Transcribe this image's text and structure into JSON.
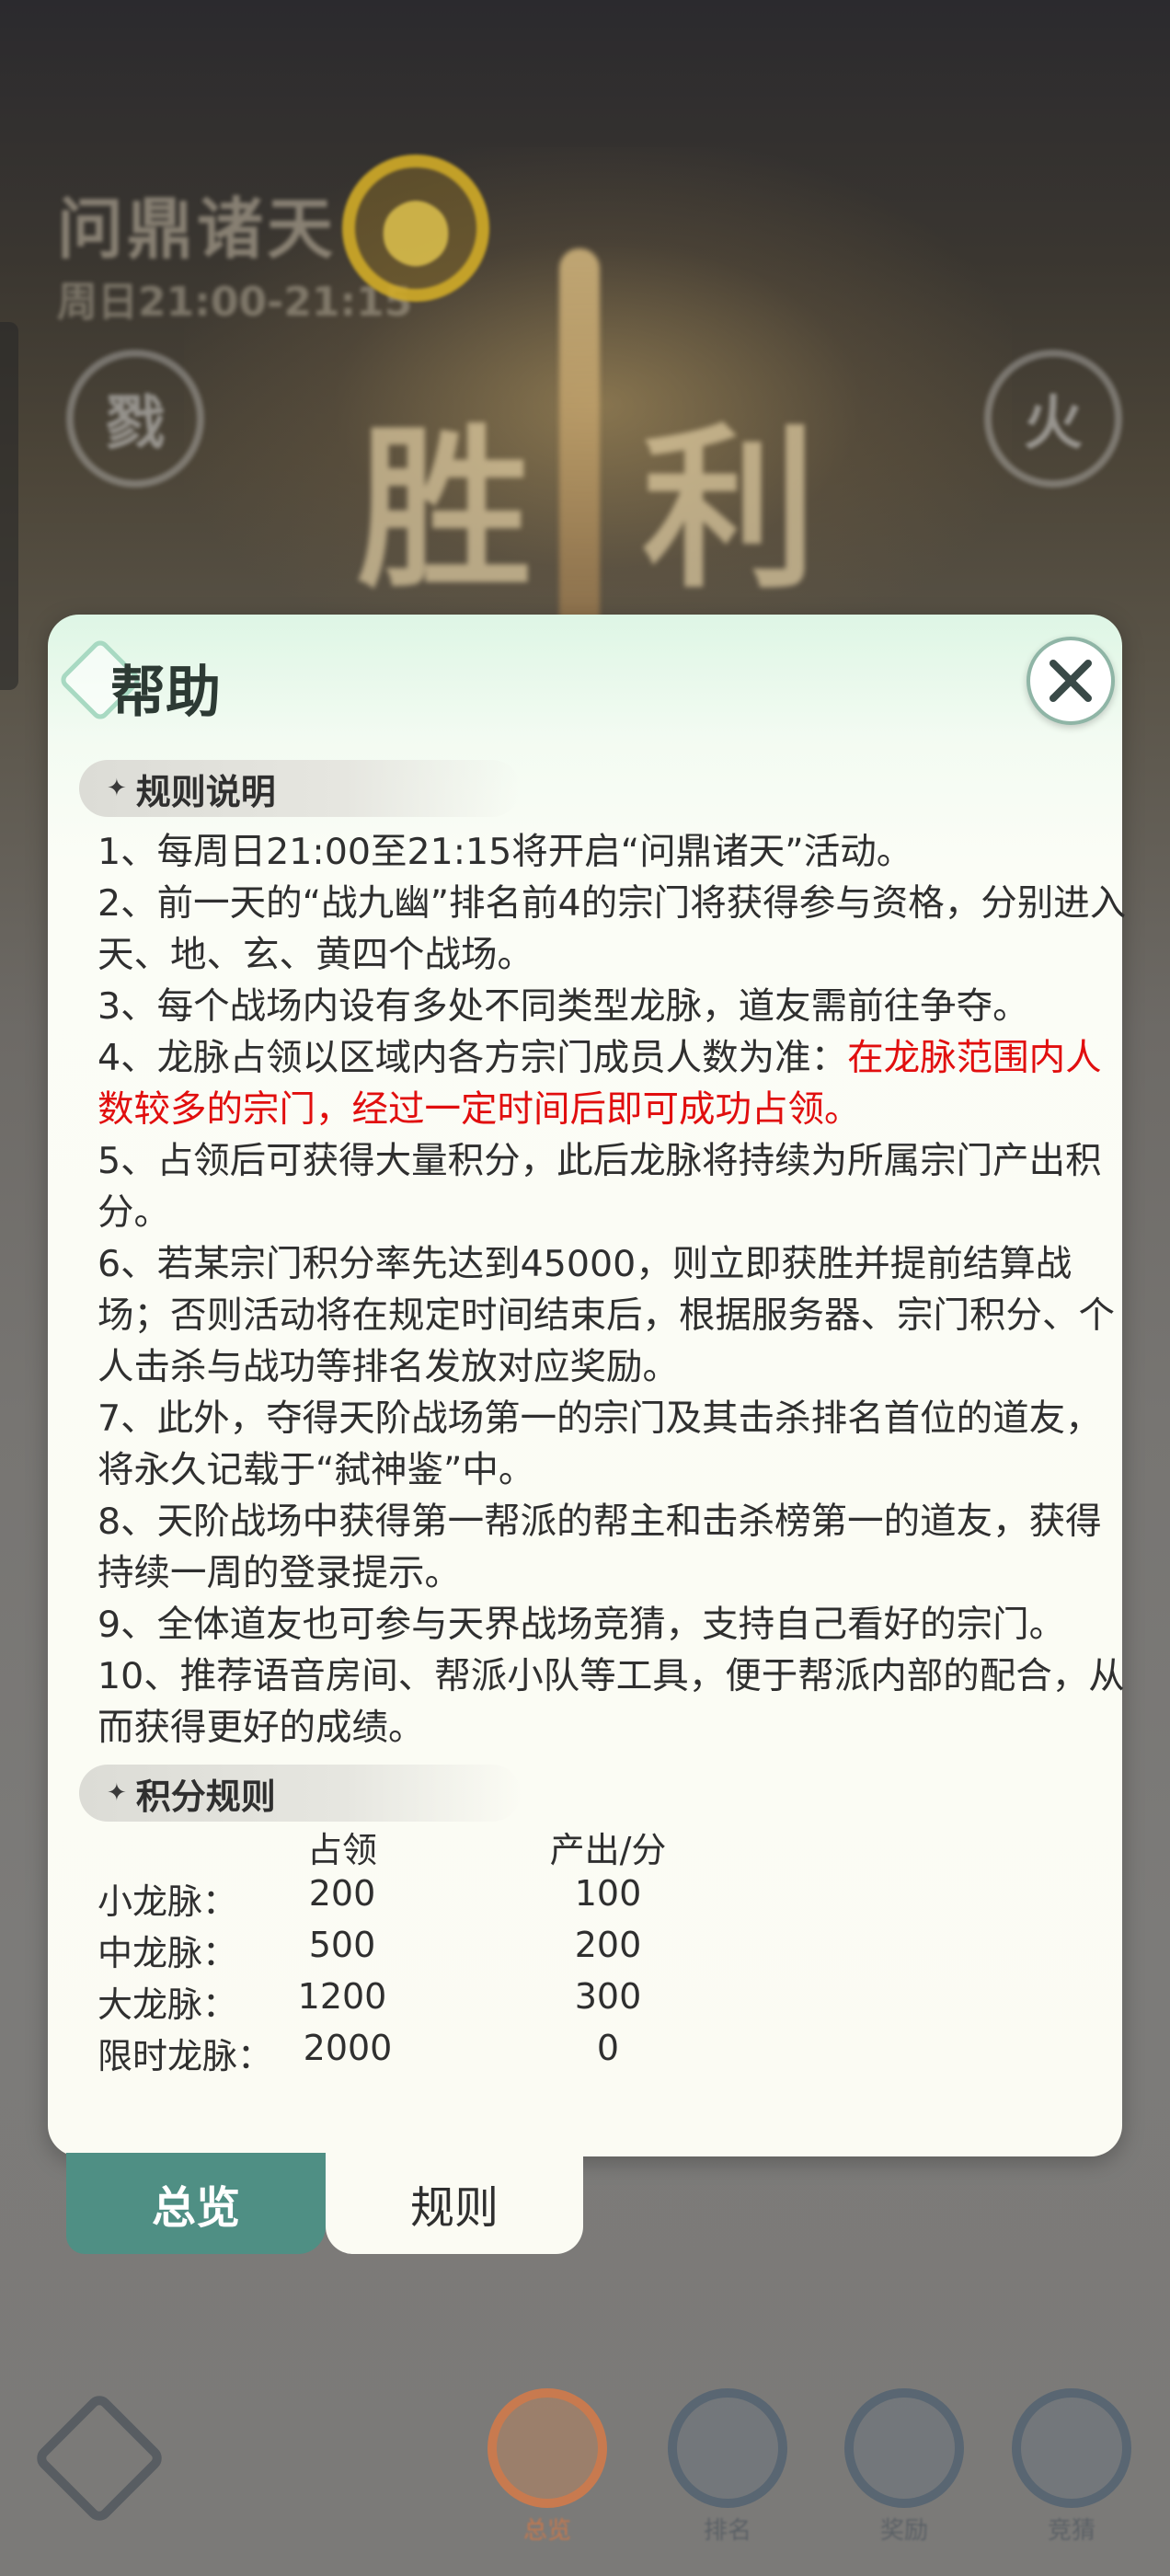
{
  "background": {
    "event_title": "问鼎诸天",
    "event_time": "周日21:00-21:15",
    "victory_text": "胜利",
    "left_icon_glyph": "戮",
    "right_icon_glyph": "火"
  },
  "dialog": {
    "title": "帮助",
    "close_icon": "close-icon",
    "sections": {
      "rules_header": "规则说明",
      "score_header": "积分规则"
    },
    "rules": [
      {
        "text": "1、每周日21:00至21:15将开启“问鼎诸天”活动。"
      },
      {
        "text": "2、前一天的“战九幽”排名前4的宗门将获得参与资格，分别进入天、地、玄、黄四个战场。"
      },
      {
        "text": "3、每个战场内设有多处不同类型龙脉，道友需前往争夺。"
      },
      {
        "text": "4、龙脉占领以区域内各方宗门成员人数为准：",
        "highlight": "在龙脉范围内人数较多的宗门，经过一定时间后即可成功占领。"
      },
      {
        "text": "5、占领后可获得大量积分，此后龙脉将持续为所属宗门产出积分。"
      },
      {
        "text": "6、若某宗门积分率先达到45000，则立即获胜并提前结算战场；否则活动将在规定时间结束后，根据服务器、宗门积分、个人击杀与战功等排名发放对应奖励。"
      },
      {
        "text": "7、此外，夺得天阶战场第一的宗门及其击杀排名首位的道友，将永久记载于“弑神鉴”中。"
      },
      {
        "text": "8、天阶战场中获得第一帮派的帮主和击杀榜第一的道友，获得持续一周的登录提示。"
      },
      {
        "text": "9、全体道友也可参与天界战场竞猜，支持自己看好的宗门。"
      },
      {
        "text": "10、推荐语音房间、帮派小队等工具，便于帮派内部的配合，从而获得更好的成绩。"
      }
    ],
    "score_table": {
      "headers": [
        "",
        "占领",
        "产出/分"
      ],
      "rows": [
        [
          "小龙脉：",
          "200",
          "100"
        ],
        [
          "中龙脉：",
          "500",
          "200"
        ],
        [
          "大龙脉：",
          "1200",
          "300"
        ],
        [
          "限时龙脉：",
          "2000",
          "0"
        ]
      ]
    }
  },
  "tabs": {
    "overview": "总览",
    "rules": "规则"
  },
  "bottom_nav": [
    {
      "label": "总览"
    },
    {
      "label": "排名"
    },
    {
      "label": "奖励"
    },
    {
      "label": "竞猜"
    }
  ],
  "colors": {
    "accent_green": "#4f8f84",
    "highlight_red": "#e10e0e"
  }
}
